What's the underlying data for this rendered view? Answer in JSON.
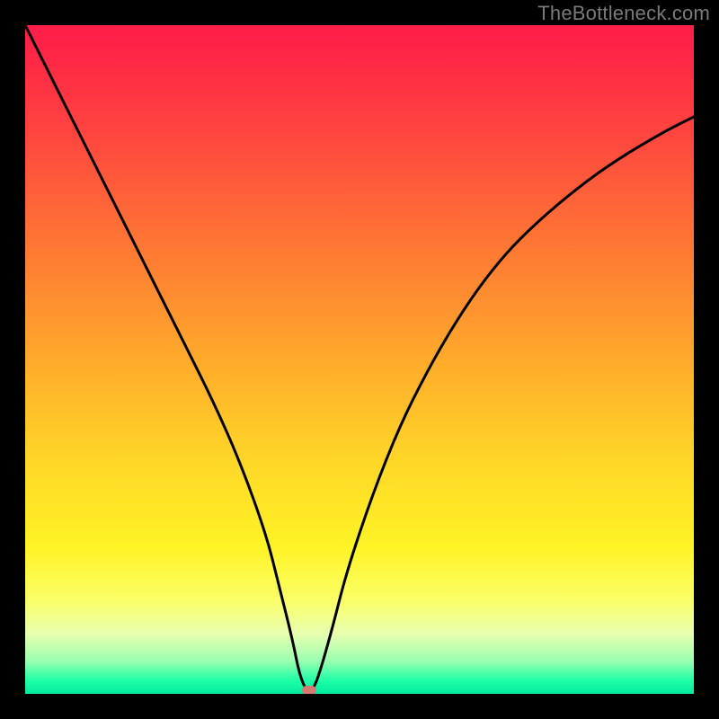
{
  "watermark": "TheBottleneck.com",
  "chart_data": {
    "type": "line",
    "title": "",
    "xlabel": "",
    "ylabel": "",
    "xlim": [
      0,
      100
    ],
    "ylim": [
      0,
      100
    ],
    "x": [
      0,
      4,
      8,
      12,
      16,
      20,
      24,
      28,
      32,
      36,
      38,
      40,
      41,
      42,
      43,
      44,
      46,
      48,
      52,
      56,
      60,
      64,
      68,
      72,
      76,
      80,
      84,
      88,
      92,
      96,
      100
    ],
    "values": [
      100,
      92,
      84,
      76,
      68,
      60,
      52,
      44,
      35,
      24,
      16,
      8,
      3,
      0.5,
      0.5,
      3,
      10,
      18,
      30,
      40,
      48,
      55,
      61,
      66,
      70,
      73.5,
      76.7,
      79.5,
      82,
      84.3,
      86.3
    ],
    "marker": {
      "x": 42.5,
      "y": 0.5
    },
    "gradient_colors": {
      "top": "#ff1d49",
      "mid": "#ffd927",
      "bottom": "#00eca0"
    }
  }
}
